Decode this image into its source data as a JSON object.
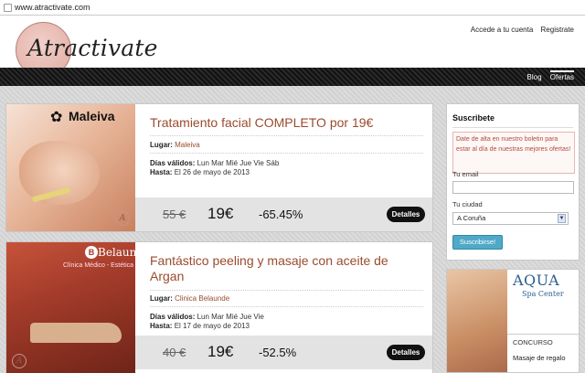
{
  "browser": {
    "url": "www.atractivate.com"
  },
  "header": {
    "logo_text": "Atractivate",
    "links": [
      "Accede a tu cuenta",
      "Registrate"
    ],
    "nav": [
      "Blog",
      "Ofertas"
    ]
  },
  "offers": [
    {
      "brand": "Maleiva",
      "title_line1": "Tratamiento facial COMPLETO por 19€",
      "title_line2": "",
      "lugar_label": "Lugar:",
      "lugar": "Maleiva",
      "dias_label": "Días válidos:",
      "dias": "Lun Mar Mié Jue Vie Sáb",
      "hasta_label": "Hasta:",
      "hasta": "El 26 de mayo de 2013",
      "old_price": "55 €",
      "new_price": "19€",
      "discount": "-65.45%",
      "details": "Detalles"
    },
    {
      "brand": "Belaunde",
      "brand_logo": "B",
      "brand_sub": "Clínica Médico - Estética",
      "title_line1": "Fantástico peeling y masaje con aceite de",
      "title_line2": "Argan",
      "lugar_label": "Lugar:",
      "lugar": "Clinica Belaunde",
      "dias_label": "Días válidos:",
      "dias": "Lun Mar Mié Jue Vie",
      "hasta_label": "Hasta:",
      "hasta": "El 17 de mayo de 2013",
      "old_price": "40 €",
      "new_price": "19€",
      "discount": "-52.5%",
      "details": "Detalles"
    }
  ],
  "sidebar": {
    "title": "Suscribete",
    "note": "Date de alta en nuestro boletin para estar al día de nuestras mejores ofertas!",
    "email_label": "Tu email",
    "city_label": "Tu ciudad",
    "city_value": "A Coruña",
    "button": "Suscribirse!"
  },
  "ad": {
    "title": "AQUA",
    "subtitle": "Spa Center",
    "concurso": "CONCURSO",
    "masaje": "Masaje de regalo"
  }
}
